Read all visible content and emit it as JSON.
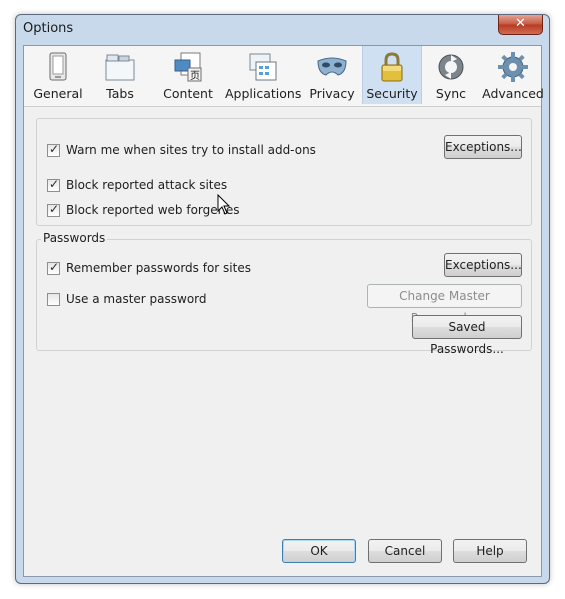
{
  "window": {
    "title": "Options",
    "close_symbol": "✕"
  },
  "tabs": [
    {
      "label": "General",
      "icon": "general-icon"
    },
    {
      "label": "Tabs",
      "icon": "tabs-icon"
    },
    {
      "label": "Content",
      "icon": "content-icon"
    },
    {
      "label": "Applications",
      "icon": "applications-icon"
    },
    {
      "label": "Privacy",
      "icon": "privacy-mask-icon"
    },
    {
      "label": "Security",
      "icon": "padlock-icon",
      "selected": true
    },
    {
      "label": "Sync",
      "icon": "sync-icon"
    },
    {
      "label": "Advanced",
      "icon": "gear-icon"
    }
  ],
  "general_group": {
    "warn_addons": {
      "label": "Warn me when sites try to install add-ons",
      "checked": true
    },
    "block_attack": {
      "label": "Block reported attack sites",
      "checked": true
    },
    "block_forgeries": {
      "label": "Block reported web forgeries",
      "checked": true
    },
    "exceptions_button": "Exceptions..."
  },
  "passwords_group": {
    "title": "Passwords",
    "remember": {
      "label": "Remember passwords for sites",
      "checked": true
    },
    "master": {
      "label": "Use a master password",
      "checked": false
    },
    "exceptions_button": "Exceptions...",
    "change_master_button": "Change Master Password...",
    "saved_passwords_button": "Saved Passwords..."
  },
  "footer": {
    "ok": "OK",
    "cancel": "Cancel",
    "help": "Help"
  },
  "colors": {
    "selected_tab": "#cfe0f3",
    "frame": "#c8d9ec",
    "close": "#c65a43"
  }
}
